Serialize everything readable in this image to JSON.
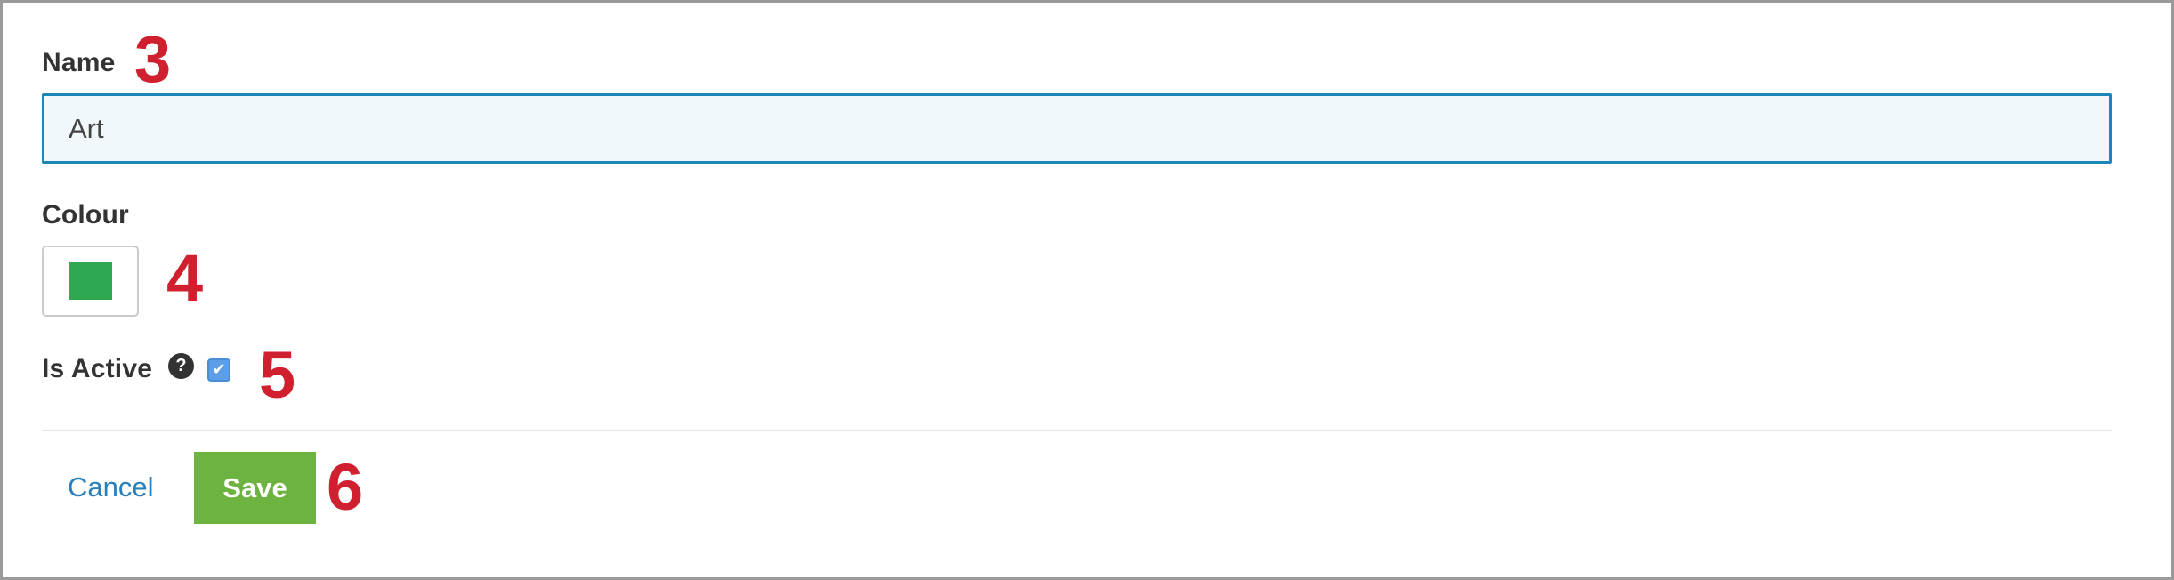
{
  "form": {
    "name_label": "Name",
    "name_value": "Art",
    "colour_label": "Colour",
    "colour_value": "#2fa84f",
    "is_active_label": "Is Active",
    "help_icon": "question-circle-icon",
    "help_glyph": "?",
    "is_active_checked": true,
    "check_glyph": "✔"
  },
  "actions": {
    "cancel_label": "Cancel",
    "save_label": "Save"
  },
  "annotations": {
    "name_marker": "3",
    "colour_marker": "4",
    "active_marker": "5",
    "save_marker": "6"
  },
  "colors": {
    "input_border": "#1c86b8",
    "input_background": "#f0f8fb",
    "link": "#2a7fb8",
    "save_button": "#6cb33f",
    "annotation_marker": "#d0202f",
    "checkbox": "#5d9ee6"
  }
}
